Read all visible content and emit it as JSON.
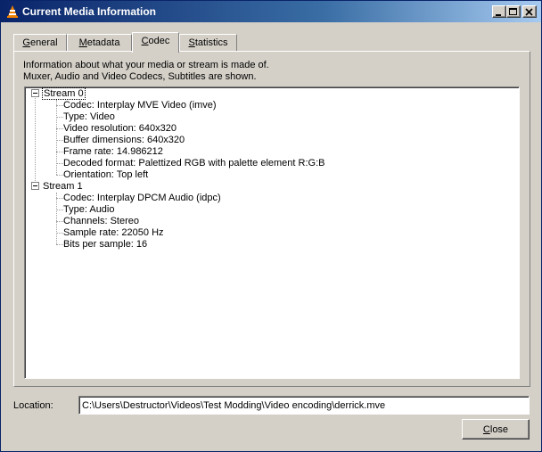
{
  "window": {
    "title": "Current Media Information",
    "icon": "vlc-cone-icon",
    "controls": [
      "minimize-icon",
      "maximize-icon",
      "close-icon"
    ]
  },
  "tabs": [
    {
      "label_first": "G",
      "label_rest": "eneral",
      "active": false
    },
    {
      "label_first": "M",
      "label_rest": "etadata",
      "active": false
    },
    {
      "label_first": "C",
      "label_rest": "odec",
      "active": true
    },
    {
      "label_first": "S",
      "label_rest": "tatistics",
      "active": false
    }
  ],
  "codec": {
    "description_line1": "Information about what your media or stream is made of.",
    "description_line2": "Muxer, Audio and Video Codecs, Subtitles are shown.",
    "streams": [
      {
        "label": "Stream 0",
        "items": [
          "Codec: Interplay MVE Video (imve)",
          "Type: Video",
          "Video resolution: 640x320",
          "Buffer dimensions: 640x320",
          "Frame rate: 14.986212",
          "Decoded format: Palettized RGB with palette element R:G:B",
          "Orientation: Top left"
        ]
      },
      {
        "label": "Stream 1",
        "items": [
          "Codec: Interplay DPCM Audio (idpc)",
          "Type: Audio",
          "Channels: Stereo",
          "Sample rate: 22050 Hz",
          "Bits per sample: 16"
        ]
      }
    ]
  },
  "location": {
    "label": "Location:",
    "value": "C:\\Users\\Destructor\\Videos\\Test Modding\\Video encoding\\derrick.mve"
  },
  "close_button": {
    "label_first": "C",
    "label_rest": "lose"
  }
}
